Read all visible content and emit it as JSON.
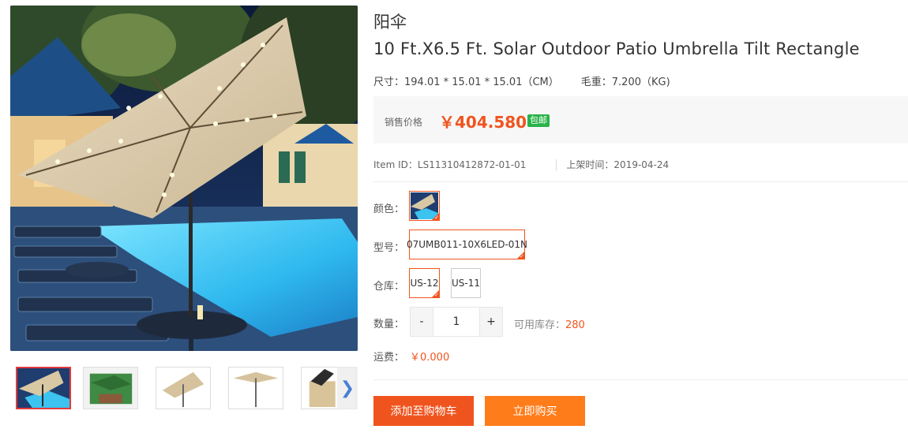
{
  "product": {
    "category_title": "阳伞",
    "title": "10 Ft.X6.5 Ft. Solar Outdoor Patio Umbrella Tilt Rectangle",
    "size_label": "尺寸：",
    "size_value": "194.01 * 15.01 * 15.01（CM）",
    "weight_label": "毛重：",
    "weight_value": "7.200（KG)",
    "price_label": "销售价格",
    "price": "￥404.580",
    "free_shipping_badge": "包邮",
    "item_id_label": "Item ID：",
    "item_id": "LS11310412872-01-01",
    "listed_label": "上架时间：",
    "listed_date": "2019-04-24"
  },
  "options": {
    "color_label": "颜色：",
    "model_label": "型号：",
    "model_value": "07UMB011-10X6LED-01N",
    "warehouse_label": "仓库：",
    "warehouses": [
      "US-12",
      "US-11"
    ],
    "quantity_label": "数量：",
    "quantity_minus": "-",
    "quantity_value": "1",
    "quantity_plus": "+",
    "stock_label": "可用库存：",
    "stock_value": "280",
    "shipping_label": "运费：",
    "shipping_value": "￥0.000"
  },
  "actions": {
    "add_to_cart": "添加至购物车",
    "buy_now": "立即购买"
  },
  "gallery": {
    "next_icon": "chevron-right-icon"
  },
  "colors": {
    "accent": "#f0541e",
    "buy_now": "#ff7c1a",
    "badge": "#29b34a",
    "active_thumb": "#e4393c"
  }
}
